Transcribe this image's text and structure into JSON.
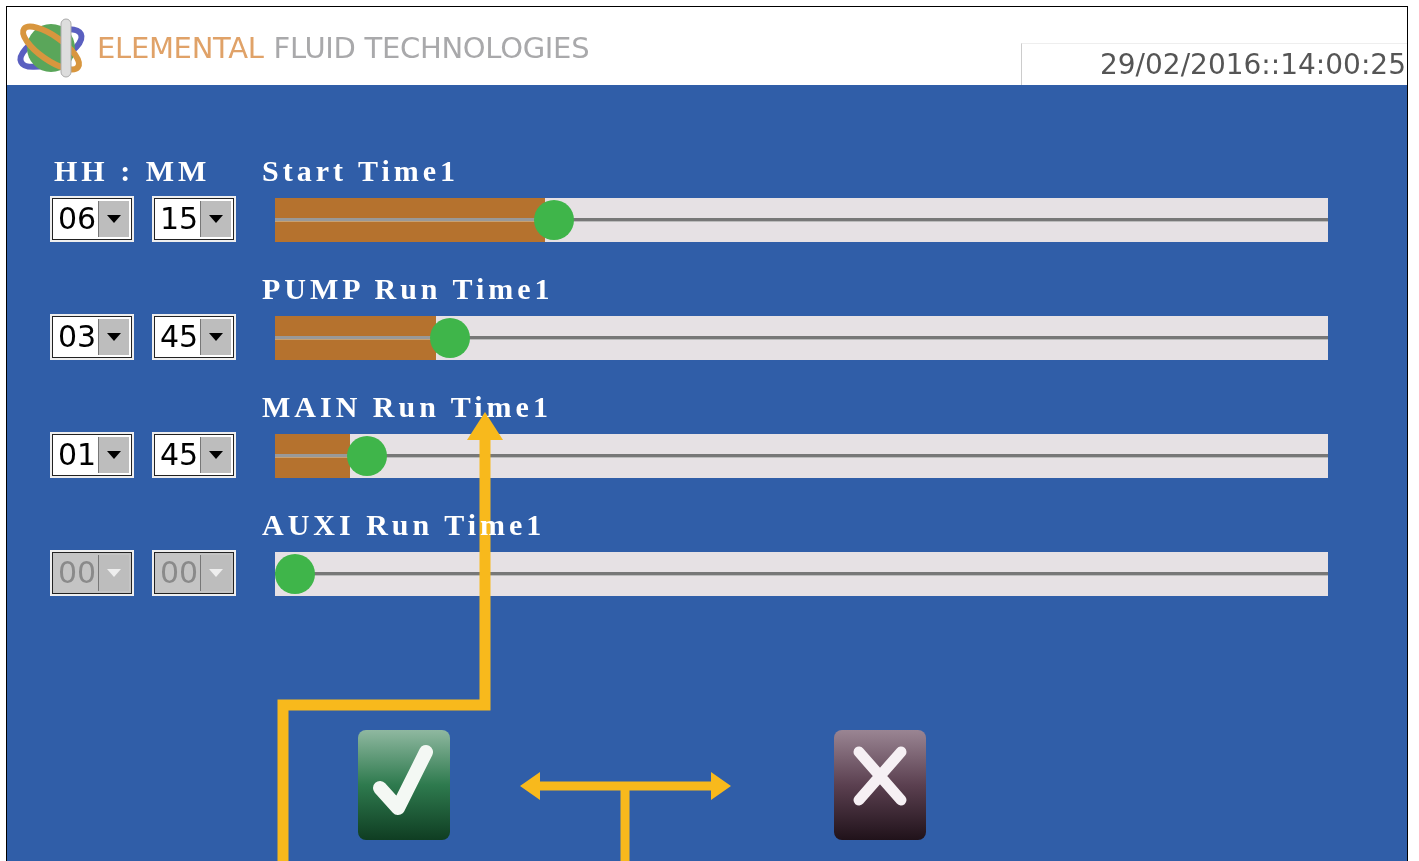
{
  "header": {
    "brand_primary": "ELEMENTAL",
    "brand_secondary": "FLUID TECHNOLOGIES",
    "datetime": "29/02/2016::14:00:25"
  },
  "time_header": "HH : MM",
  "rows": [
    {
      "label": "Start Time1",
      "hours": "06",
      "minutes": "15",
      "level": 0.256,
      "disabled": false
    },
    {
      "label": "PUMP Run Time1",
      "hours": "03",
      "minutes": "45",
      "level": 0.153,
      "disabled": false
    },
    {
      "label": "MAIN Run Time1",
      "hours": "01",
      "minutes": "45",
      "level": 0.071,
      "disabled": false
    },
    {
      "label": "AUXI Run Time1",
      "hours": "00",
      "minutes": "00",
      "level": 0,
      "disabled": true
    }
  ],
  "buttons": [
    {
      "kind": "confirm"
    },
    {
      "kind": "cancel"
    }
  ]
}
